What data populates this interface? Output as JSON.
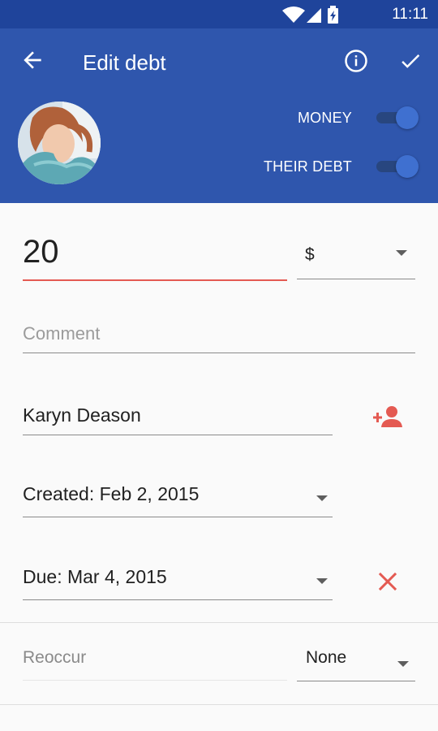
{
  "status_bar": {
    "time": "11:11"
  },
  "app_bar": {
    "title": "Edit debt",
    "toggles": [
      {
        "label": "MONEY",
        "on": true
      },
      {
        "label": "THEIR DEBT",
        "on": true
      }
    ]
  },
  "form": {
    "amount": "20",
    "currency": "$",
    "comment_placeholder": "Comment",
    "contact_name": "Karyn Deason",
    "created": "Created: Feb 2, 2015",
    "due": "Due: Mar 4, 2015",
    "reoccur_label": "Reoccur",
    "reoccur_value": "None"
  },
  "colors": {
    "primary": "#2f56ad",
    "primary_dark": "#1f449b",
    "accent": "#e45a52"
  }
}
